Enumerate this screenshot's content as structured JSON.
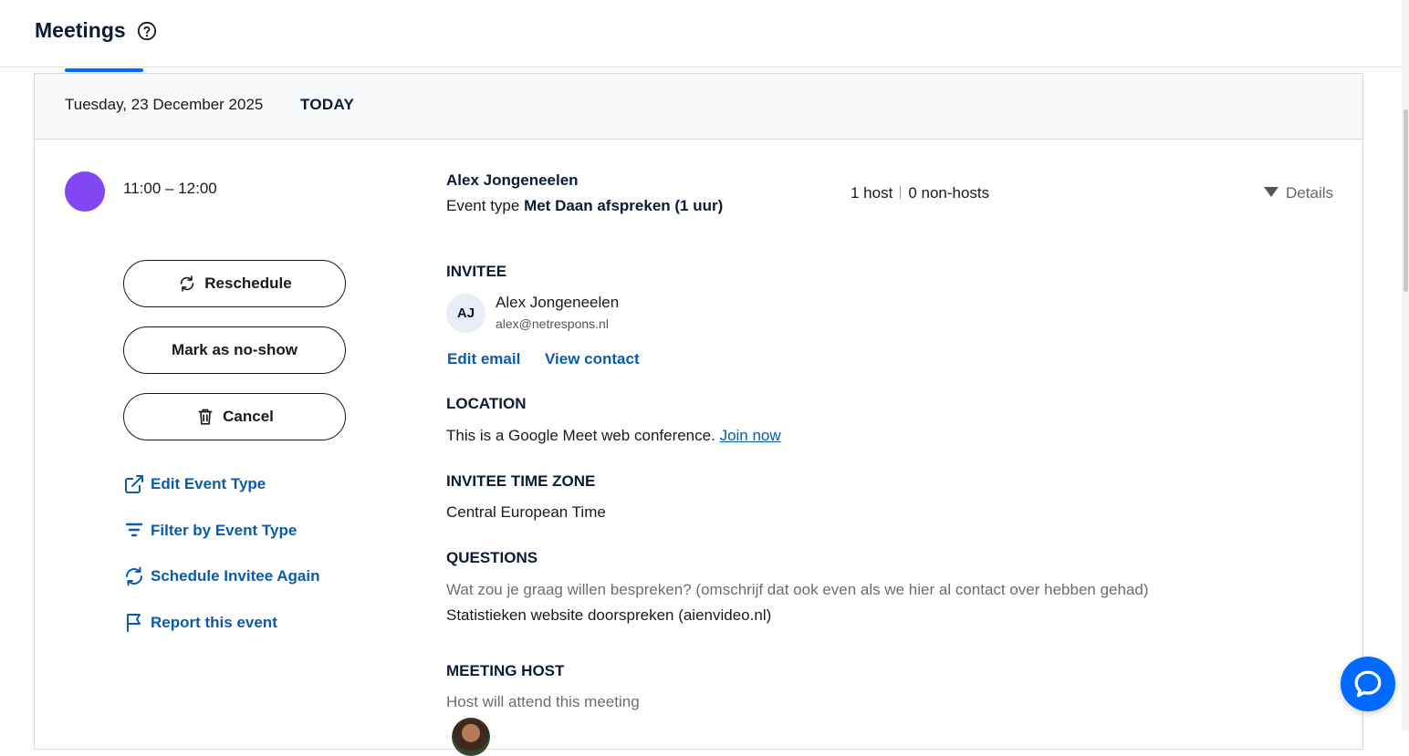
{
  "header": {
    "title": "Meetings",
    "help_icon": "help-circle-icon"
  },
  "date_header": {
    "date": "Tuesday, 23 December 2025",
    "today_label": "TODAY"
  },
  "event": {
    "color": "#8247f5",
    "time": "11:00 – 12:00",
    "name": "Alex Jongeneelen",
    "event_type_prefix": "Event type",
    "event_type_name": "Met Daan afspreken (1 uur)",
    "hosts": "1 host",
    "non_hosts": "0 non-hosts",
    "details_label": "Details"
  },
  "actions": {
    "reschedule": "Reschedule",
    "mark_no_show": "Mark as no-show",
    "cancel": "Cancel"
  },
  "links": {
    "edit_event_type": "Edit Event Type",
    "filter_by_event_type": "Filter by Event Type",
    "schedule_again": "Schedule Invitee Again",
    "report": "Report this event"
  },
  "invitee": {
    "section_title": "INVITEE",
    "initials": "AJ",
    "name": "Alex Jongeneelen",
    "email": "alex@netrespons.nl",
    "edit_email": "Edit email",
    "view_contact": "View contact"
  },
  "location": {
    "section_title": "LOCATION",
    "text": "This is a Google Meet web conference.",
    "join_link": "Join now"
  },
  "timezone": {
    "section_title": "INVITEE TIME ZONE",
    "value": "Central European Time"
  },
  "questions": {
    "section_title": "QUESTIONS",
    "question": "Wat zou je graag willen bespreken? (omschrijf dat ook even als we hier al contact over hebben gehad)",
    "answer": "Statistieken website doorspreken (aienvideo.nl)"
  },
  "meeting_host": {
    "section_title": "MEETING HOST",
    "note": "Host will attend this meeting"
  },
  "colors": {
    "accent": "#0069ff",
    "link": "#0b5ca8",
    "event_dot": "#8247f5"
  }
}
